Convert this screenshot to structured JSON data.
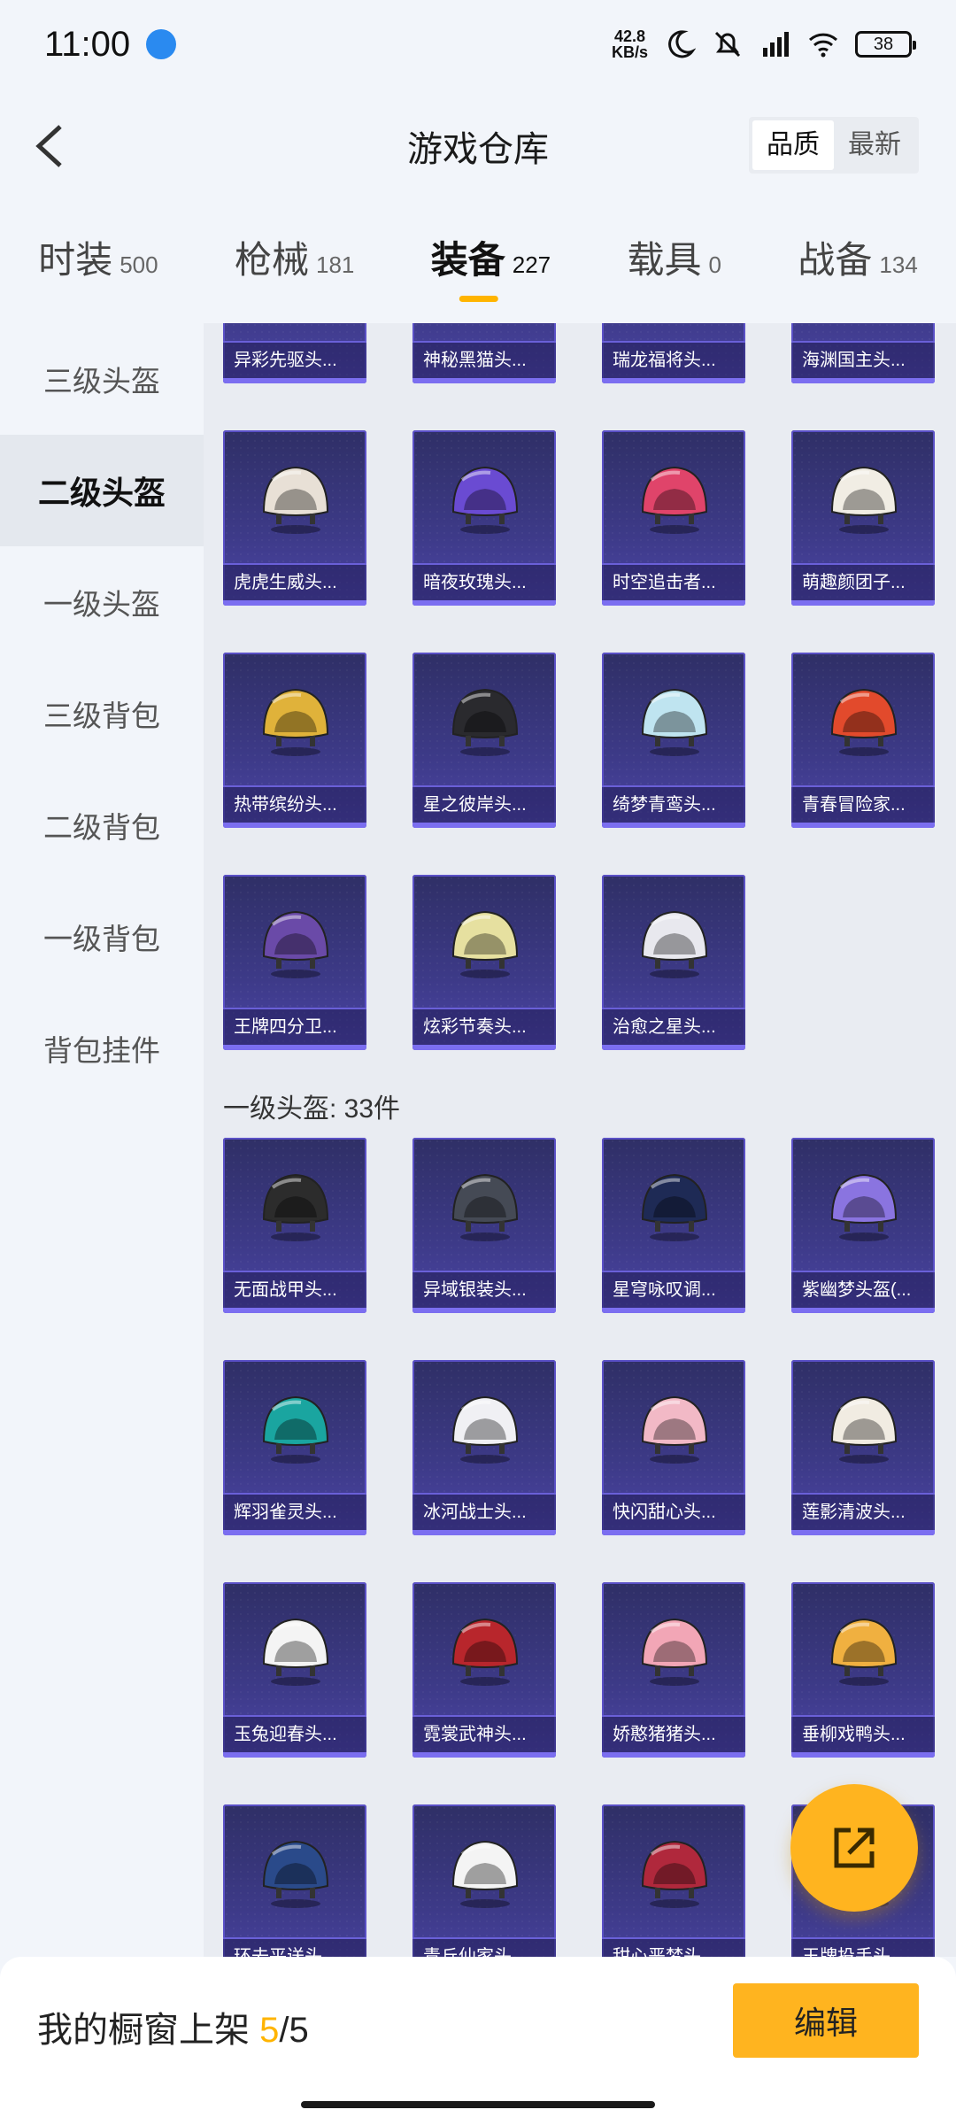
{
  "status": {
    "time": "11:00",
    "net_speed_value": "42.8",
    "net_speed_unit": "KB/s",
    "battery": "38"
  },
  "header": {
    "title": "游戏仓库",
    "sort_options": [
      "品质",
      "最新"
    ]
  },
  "tabs": [
    {
      "label": "时装",
      "count": "500"
    },
    {
      "label": "枪械",
      "count": "181"
    },
    {
      "label": "装备",
      "count": "227"
    },
    {
      "label": "载具",
      "count": "0"
    },
    {
      "label": "战备",
      "count": "134"
    }
  ],
  "sidebar": [
    "三级头盔",
    "二级头盔",
    "一级头盔",
    "三级背包",
    "二级背包",
    "一级背包",
    "背包挂件"
  ],
  "level2_items": [
    {
      "name": "异彩先驱头...",
      "color": "#d9d9d9"
    },
    {
      "name": "神秘黑猫头...",
      "color": "#3a3a3a"
    },
    {
      "name": "瑞龙福将头...",
      "color": "#c43a3a"
    },
    {
      "name": "海渊国主头...",
      "color": "#d9d9d9"
    },
    {
      "name": "虎虎生威头...",
      "color": "#e8e0d6"
    },
    {
      "name": "暗夜玫瑰头...",
      "color": "#6a4bd2"
    },
    {
      "name": "时空追击者...",
      "color": "#e0446a"
    },
    {
      "name": "萌趣颜团子...",
      "color": "#f1ede4"
    },
    {
      "name": "热带缤纷头...",
      "color": "#e0b23a"
    },
    {
      "name": "星之彼岸头...",
      "color": "#2a2a2e"
    },
    {
      "name": "绮梦青鸾头...",
      "color": "#bfe4f0"
    },
    {
      "name": "青春冒险家...",
      "color": "#e24a2c"
    },
    {
      "name": "王牌四分卫...",
      "color": "#6a4aa8"
    },
    {
      "name": "炫彩节奏头...",
      "color": "#e6e0a0"
    },
    {
      "name": "治愈之星头...",
      "color": "#e8e8ee"
    }
  ],
  "section_level1": {
    "label": "一级头盔: 33件"
  },
  "level1_items": [
    {
      "name": "无面战甲头...",
      "color": "#2c2c2c"
    },
    {
      "name": "异域银装头...",
      "color": "#454a55"
    },
    {
      "name": "星穹咏叹调...",
      "color": "#1e2a55"
    },
    {
      "name": "紫幽梦头盔(...",
      "color": "#8a74e0"
    },
    {
      "name": "辉羽雀灵头...",
      "color": "#1aa5a0"
    },
    {
      "name": "冰河战士头...",
      "color": "#f0f0f4"
    },
    {
      "name": "快闪甜心头...",
      "color": "#f2b9c6"
    },
    {
      "name": "莲影清波头...",
      "color": "#f1ece2"
    },
    {
      "name": "玉兔迎春头...",
      "color": "#f4f4f4"
    },
    {
      "name": "霓裳武神头...",
      "color": "#b8262c"
    },
    {
      "name": "娇憨猪猪头...",
      "color": "#f2a6b6"
    },
    {
      "name": "垂柳戏鸭头...",
      "color": "#f0b040"
    },
    {
      "name": "环去平送头...",
      "color": "#2a4a8a"
    },
    {
      "name": "青丘仙家头...",
      "color": "#f4f4f4"
    },
    {
      "name": "甜心恶梦头...",
      "color": "#b0283c"
    },
    {
      "name": "王牌投手头...",
      "color": "#e8e8e8"
    }
  ],
  "bottom": {
    "label": "我的橱窗上架",
    "current": "5",
    "total": "/5",
    "edit": "编辑"
  }
}
